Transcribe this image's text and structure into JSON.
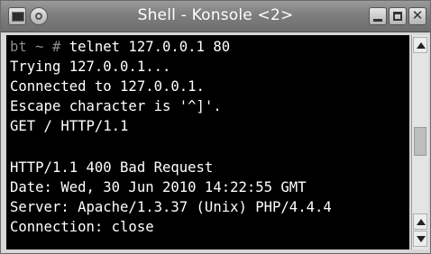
{
  "window": {
    "title": "Shell - Konsole <2>",
    "controls": {
      "app_icon": "terminal-app-icon",
      "sticky": "sticky-icon",
      "minimize": "minimize-icon",
      "maximize": "maximize-icon",
      "close_glyph": "✕"
    }
  },
  "terminal": {
    "prompt": "bt ~ # ",
    "command": "telnet 127.0.0.1 80",
    "lines": [
      "Trying 127.0.0.1...",
      "Connected to 127.0.0.1.",
      "Escape character is '^]'.",
      "GET / HTTP/1.1",
      "",
      "HTTP/1.1 400 Bad Request",
      "Date: Wed, 30 Jun 2010 14:22:55 GMT",
      "Server: Apache/1.3.37 (Unix) PHP/4.4.4",
      "Connection: close"
    ]
  },
  "scrollbar": {
    "up_icon": "arrow-up-icon",
    "down_icon": "arrow-down-icon",
    "scroll_position_fraction": 0.45
  },
  "colors": {
    "terminal_bg": "#000000",
    "terminal_fg": "#ffffff",
    "prompt_fg": "#8c8c8c",
    "titlebar": "#7e7e7e"
  }
}
